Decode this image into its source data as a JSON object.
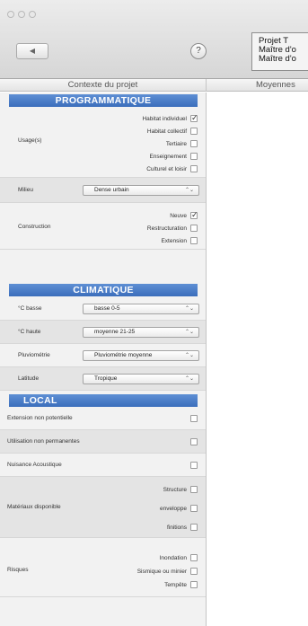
{
  "window": {
    "back_label": "◀",
    "help_label": "?",
    "project_lines": [
      "Projet T",
      "Maître d'o",
      "Maître d'o"
    ]
  },
  "columns": {
    "left": "Contexte du projet",
    "right": "Moyennes"
  },
  "sections": {
    "programmatique": "PROGRAMMATIQUE",
    "climatique": "CLIMATIQUE",
    "local": "LOCAL"
  },
  "usage": {
    "label": "Usage(s)",
    "options": [
      {
        "label": "Habitat individuel",
        "checked": true
      },
      {
        "label": "Habitat collectif",
        "checked": false
      },
      {
        "label": "Tertiaire",
        "checked": false
      },
      {
        "label": "Enseignement",
        "checked": false
      },
      {
        "label": "Culturel et loisir",
        "checked": false
      }
    ]
  },
  "milieu": {
    "label": "Milieu",
    "value": "Dense urbain"
  },
  "construction": {
    "label": "Construction",
    "options": [
      {
        "label": "Neuve",
        "checked": true
      },
      {
        "label": "Restructuration",
        "checked": false
      },
      {
        "label": "Extension",
        "checked": false
      }
    ]
  },
  "climat": {
    "t_basse": {
      "label": "°C basse",
      "value": "basse 0-5"
    },
    "t_haute": {
      "label": "°C haute",
      "value": "moyenne 21-25"
    },
    "pluvio": {
      "label": "Pluviométrie",
      "value": "Pluviométrie moyenne"
    },
    "latitude": {
      "label": "Latitude",
      "value": "Tropique"
    }
  },
  "local": {
    "extension": {
      "label": "Extension non potentielle",
      "checked": false
    },
    "utilisation": {
      "label": "Utilisation non permanentes",
      "checked": false
    },
    "nuisance": {
      "label": "Nuisance Acoustique",
      "checked": false
    },
    "materiaux": {
      "label": "Matériaux disponible",
      "options": [
        {
          "label": "Structure",
          "checked": false
        },
        {
          "label": "enveloppe",
          "checked": false
        },
        {
          "label": "finitions",
          "checked": false
        }
      ]
    },
    "risques": {
      "label": "Risques",
      "options": [
        {
          "label": "Inondation",
          "checked": false
        },
        {
          "label": "Sismique ou minier",
          "checked": false
        },
        {
          "label": "Tempête",
          "checked": false
        }
      ]
    }
  },
  "select_arrows": "⌃⌄"
}
